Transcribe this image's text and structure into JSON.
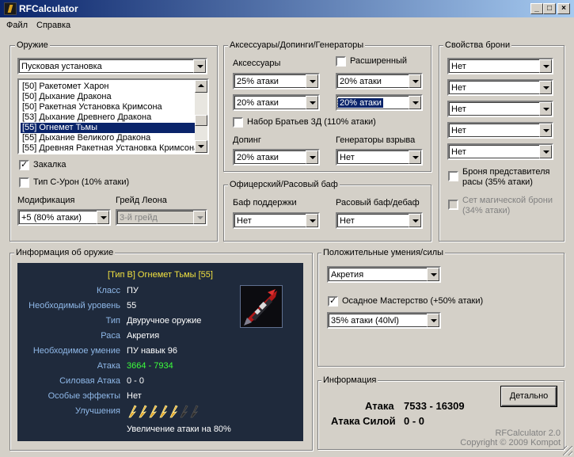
{
  "window": {
    "title": "RFCalculator"
  },
  "menu": [
    "Файл",
    "Справка"
  ],
  "weapon": {
    "title": "Оружие",
    "type_value": "Пусковая установка",
    "list": [
      "[50] Ракетомет Харон",
      "[50] Дыхание Дракона",
      "[50] Ракетная Установка Кримсона",
      "[53] Дыхание Древнего Дракона",
      "[55] Огнемет Тьмы",
      "[55] Дыхание Великого Дракона",
      "[55] Древняя Ракетная Установка Кримсона"
    ],
    "selected_index": 4,
    "hardening_label": "Закалка",
    "hardening_checked": true,
    "type_c_label": "Тип С-Урон (10% атаки)",
    "type_c_checked": false,
    "modification_label": "Модификация",
    "modification_value": "+5 (80% атаки)",
    "leon_label": "Грейд Леона",
    "leon_value": "3-й грейд"
  },
  "accessories": {
    "title": "Аксессуары/Допинги/Генераторы",
    "acc_label": "Аксессуары",
    "extended_label": "Расширенный",
    "extended_checked": false,
    "combo1": "25% атаки",
    "combo2": "20% атаки",
    "combo3": "20% атаки",
    "combo4": "20% атаки",
    "brothers_label": "Набор Братьев 3Д (110% атаки)",
    "brothers_checked": false,
    "doping_label": "Допинг",
    "doping_value": "20% атаки",
    "generators_label": "Генераторы взрыва",
    "generators_value": "Нет"
  },
  "officer": {
    "title": "Офицерский/Расовый баф",
    "support_label": "Баф поддержки",
    "support_value": "Нет",
    "race_label": "Расовый баф/дебаф",
    "race_value": "Нет"
  },
  "armor": {
    "title": "Свойства брони",
    "values": [
      "Нет",
      "Нет",
      "Нет",
      "Нет",
      "Нет"
    ],
    "race_rep_label_1": "Броня представителя",
    "race_rep_label_2": "расы (35% атаки)",
    "race_rep_checked": false,
    "magic_set_label_1": "Сет магической брони",
    "magic_set_label_2": "(34% атаки)",
    "magic_set_checked": false
  },
  "info": {
    "title": "Информация об оружие",
    "header": "[Тип B] Огнемет Тьмы [55]",
    "rows": [
      {
        "k": "Класс",
        "v": "ПУ"
      },
      {
        "k": "Необходимый уровень",
        "v": "55"
      },
      {
        "k": "Тип",
        "v": "Двуручное оружие"
      },
      {
        "k": "Раса",
        "v": "Акретия"
      },
      {
        "k": "Необходимое умение",
        "v": "ПУ навык 96"
      },
      {
        "k": "Атака",
        "v": "3664 - 7934"
      },
      {
        "k": "Силовая Атака",
        "v": "0 - 0"
      },
      {
        "k": "Особые эффекты",
        "v": "Нет"
      },
      {
        "k": "Улучшения",
        "v": ""
      }
    ],
    "attack_color": "#3cff3c",
    "upgrades_filled": 5,
    "upgrades_total": 7,
    "upgrade_text": "Увеличение атаки на 80%"
  },
  "skills": {
    "title": "Положительные умения/силы",
    "race_value": "Акретия",
    "siege_label": "Осадное Мастерство (+50% атаки)",
    "siege_checked": true,
    "level_value": "35% атаки (40lvl)"
  },
  "result": {
    "title": "Информация",
    "detail_button": "Детально",
    "attack_label": "Атака",
    "attack_value": "7533 - 16309",
    "force_label": "Атака Силой",
    "force_value": "0 - 0",
    "version": "RFCalculator 2.0",
    "copyright": "Copyright © 2009 Kompot"
  }
}
